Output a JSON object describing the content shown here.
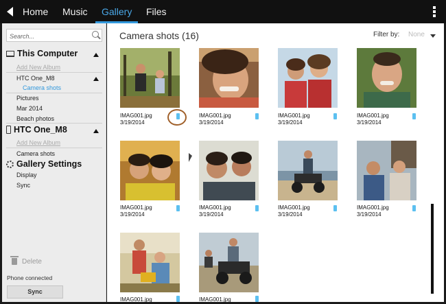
{
  "nav": {
    "tabs": [
      {
        "label": "Home"
      },
      {
        "label": "Music"
      },
      {
        "label": "Gallery"
      },
      {
        "label": "Files"
      }
    ]
  },
  "sidebar": {
    "search_placeholder": "Search...",
    "this_computer": {
      "label": "This Computer",
      "add_album": "Add New Album",
      "device": "HTC One_M8",
      "device_active_child": "Camera shots",
      "items": [
        "Pictures",
        "Mar 2014",
        "Beach photos"
      ]
    },
    "phone": {
      "label": "HTC One_M8",
      "add_album": "Add New Album",
      "items": [
        "Camera shots"
      ]
    },
    "settings": {
      "label": "Gallery Settings",
      "items": [
        "Display",
        "Sync"
      ]
    },
    "delete_label": "Delete",
    "phone_status": "Phone connected",
    "sync_label": "Sync"
  },
  "main": {
    "title": "Camera shots (16)",
    "filter_label": "Filter by:",
    "filter_value": "None",
    "photos": [
      {
        "name": "IMAG001.jpg",
        "date": "3/19/2014"
      },
      {
        "name": "IMAG001.jpg",
        "date": "3/19/2014"
      },
      {
        "name": "IMAG001.jpg",
        "date": "3/19/2014"
      },
      {
        "name": "IMAG001.jpg",
        "date": "3/19/2014"
      },
      {
        "name": "IMAG001.jpg",
        "date": "3/19/2014"
      },
      {
        "name": "IMAG001.jpg",
        "date": "3/19/2014"
      },
      {
        "name": "IMAG001.jpg",
        "date": "3/19/2014"
      },
      {
        "name": "IMAG001.jpg",
        "date": "3/19/2014"
      },
      {
        "name": "IMAG001.jpg",
        "date": ""
      },
      {
        "name": "IMAG001.jpg",
        "date": ""
      }
    ]
  },
  "colors": {
    "accent": "#3399dd",
    "topbar": "#111111",
    "sidebar": "#ececec",
    "device_badge": "#5cc0f0",
    "highlight": "#a0602a"
  }
}
